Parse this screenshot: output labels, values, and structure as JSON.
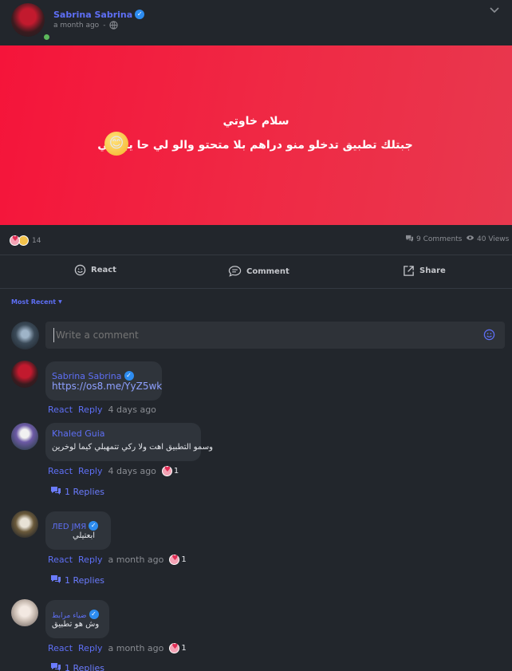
{
  "post": {
    "author": "Sabrina Sabrina",
    "time": "a month ago",
    "banner_line1": "سلام خاوتي",
    "banner_line2": "جبتلك تطبيق تدخلو منو دراهم بلا متحتو والو لي حا يبعتلي",
    "banner_emoji": "😊",
    "reaction_count": "14",
    "comments_count": "9 Comments",
    "views_count": "40 Views",
    "banner_color": "#f5143a"
  },
  "actions": {
    "react": "React",
    "comment": "Comment",
    "share": "Share"
  },
  "sort": {
    "label": "Most Recent"
  },
  "composer": {
    "placeholder": "Write a comment"
  },
  "comments": [
    {
      "author": "Sabrina Sabrina",
      "text": "https://os8.me/YyZ5wk",
      "react": "React",
      "reply": "Reply",
      "time": "4 days ago"
    },
    {
      "author": "Khaled Guia",
      "text": "وسمو التطبيق اهت ولا ركي تتمهبلي كيما لوخرين",
      "react": "React",
      "reply": "Reply",
      "time": "4 days ago",
      "reactions": "1",
      "replies": "1 Replies"
    },
    {
      "author": "ЛЕD JMЯ",
      "text": "ابعتيلي",
      "react": "React",
      "reply": "Reply",
      "time": "a month ago",
      "reactions": "1",
      "replies": "1 Replies"
    },
    {
      "author": "ضياء مرابط",
      "text": "وش هو تطبيق",
      "react": "React",
      "reply": "Reply",
      "time": "a month ago",
      "reactions": "1",
      "replies": "1 Replies"
    }
  ]
}
